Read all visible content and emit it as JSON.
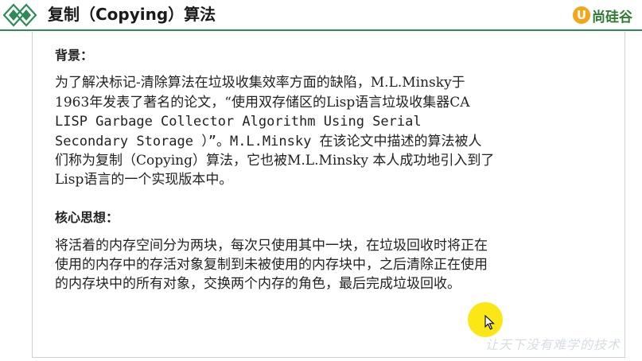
{
  "header": {
    "title": "复制（Copying）算法",
    "brand_mark": "U",
    "brand_name": "尚硅谷",
    "accent_color": "#2e8b57",
    "brand_color": "#f3a718",
    "logo_icon": "double-diamond-icon"
  },
  "sections": {
    "background": {
      "heading": "背景：",
      "lines": [
        "为了解决标记-清除算法在垃圾收集效率方面的缺陷，M.L.Minsky于",
        "1963年发表了著名的论文，“使用双存储区的Lisp语言垃圾收集器CA",
        "LISP Garbage Collector Algorithm Using Serial",
        "Secondary Storage ）”。M.L.Minsky 在该论文中描述的算法被人",
        "们称为复制（Copying）算法，它也被M.L.Minsky 本人成功地引入到了",
        "Lisp语言的一个实现版本中。"
      ]
    },
    "core_idea": {
      "heading": "核心思想：",
      "lines": [
        "将活着的内存空间分为两块，每次只使用其中一块，在垃圾回收时将正在",
        "使用的内存中的存活对象复制到未被使用的内存块中，之后清除正在使用",
        "的内存块中的所有对象，交换两个内存的角色，最后完成垃圾回收。"
      ]
    }
  },
  "cursor": {
    "icon": "mouse-pointer-icon",
    "highlight_color": "#fbe716"
  },
  "watermark": {
    "text": "让天下没有难学的技术"
  }
}
